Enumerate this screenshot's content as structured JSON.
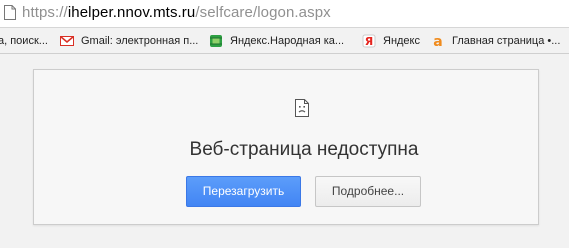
{
  "address_bar": {
    "scheme": "https://",
    "host": "ihelper.nnov.mts.ru",
    "path": "/selfcare/logon.aspx"
  },
  "bookmarks": [
    {
      "label": "а, поиск...",
      "icon": "none"
    },
    {
      "label": "Gmail: электронная п...",
      "icon": "gmail-icon"
    },
    {
      "label": "Яндекс.Народная ка...",
      "icon": "map-icon"
    },
    {
      "label": "Яндекс",
      "icon": "yandex-icon"
    },
    {
      "label": "Главная страница •...",
      "icon": "a-icon"
    }
  ],
  "error": {
    "title": "Веб-страница недоступна",
    "reload_label": "Перезагрузить",
    "details_label": "Подробнее..."
  },
  "colors": {
    "primary_button": "#4285f4",
    "gmail_red": "#d93025",
    "yandex_red": "#e52620",
    "a_orange": "#f08b1d",
    "map_green": "#2ea043"
  }
}
